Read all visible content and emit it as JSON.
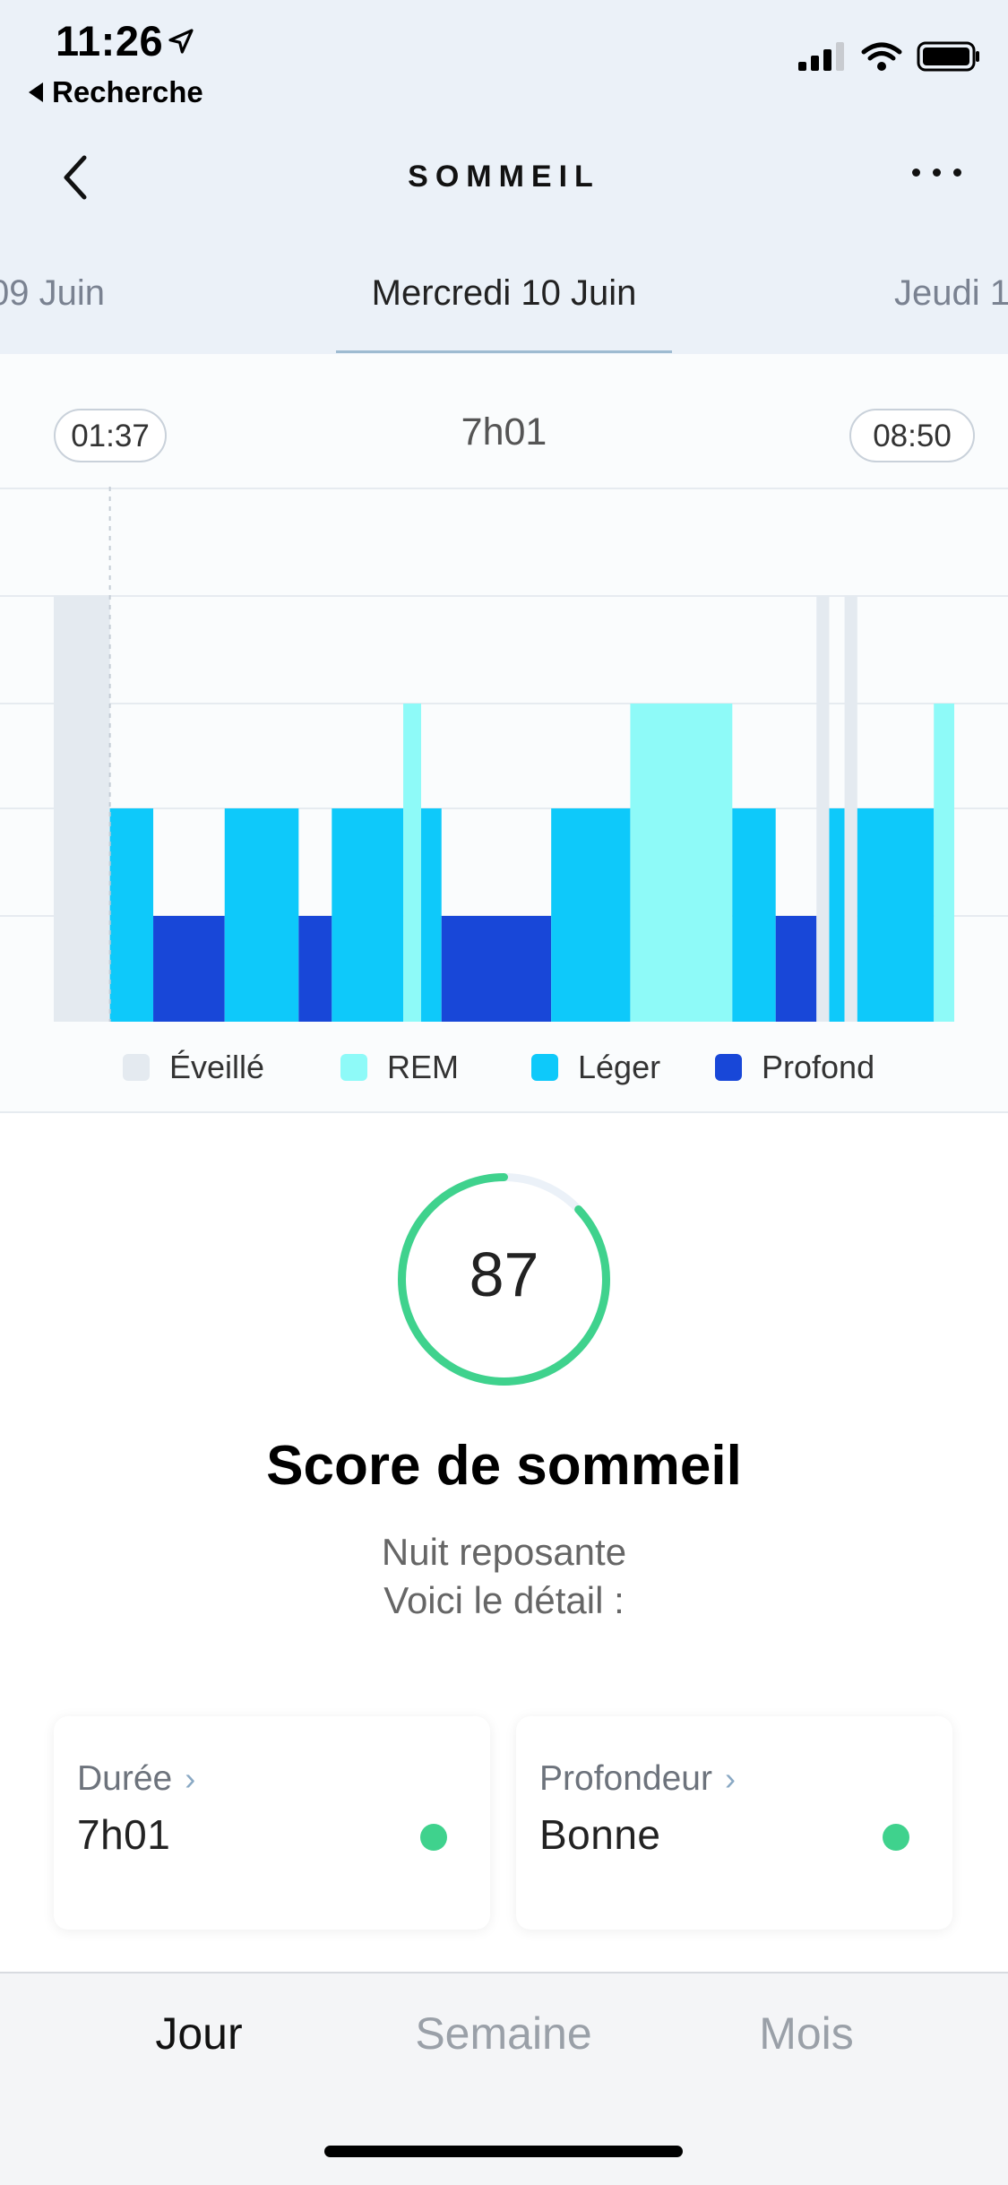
{
  "status_bar": {
    "time": "11:26",
    "back_app": "Recherche",
    "icons": [
      "location-arrow-icon",
      "cellular-signal-icon",
      "wifi-icon",
      "battery-icon"
    ]
  },
  "nav": {
    "title": "SOMMEIL",
    "back_icon": "chevron-left-icon",
    "more_icon": "more-dots-icon"
  },
  "days": {
    "prev": "09 Juin",
    "current": "Mercredi 10 Juin",
    "next": "Jeudi 1"
  },
  "chart_header": {
    "start": "01:37",
    "total": "7h01",
    "end": "08:50"
  },
  "chart_data": {
    "type": "bar",
    "title": "",
    "start_time": "01:37",
    "end_time": "08:50",
    "stage_order": [
      "Éveillé",
      "REM",
      "Léger",
      "Profond"
    ],
    "colors": {
      "Éveillé": "#e4eaf0",
      "REM": "#8efaf8",
      "Léger": "#0ec9fa",
      "Profond": "#1847d8"
    },
    "segments": [
      {
        "stage": "Éveillé",
        "from": "01:15",
        "to": "01:37"
      },
      {
        "stage": "Léger",
        "from": "01:37",
        "to": "01:54"
      },
      {
        "stage": "Profond",
        "from": "01:54",
        "to": "02:22"
      },
      {
        "stage": "Léger",
        "from": "02:22",
        "to": "02:51"
      },
      {
        "stage": "Profond",
        "from": "02:51",
        "to": "03:04"
      },
      {
        "stage": "Léger",
        "from": "03:04",
        "to": "03:32"
      },
      {
        "stage": "REM",
        "from": "03:32",
        "to": "03:39"
      },
      {
        "stage": "Léger",
        "from": "03:39",
        "to": "03:47"
      },
      {
        "stage": "Profond",
        "from": "03:47",
        "to": "04:30"
      },
      {
        "stage": "Léger",
        "from": "04:30",
        "to": "05:01"
      },
      {
        "stage": "REM",
        "from": "05:01",
        "to": "05:41"
      },
      {
        "stage": "Léger",
        "from": "05:41",
        "to": "05:58"
      },
      {
        "stage": "Profond",
        "from": "05:58",
        "to": "06:14"
      },
      {
        "stage": "Éveillé",
        "from": "06:14",
        "to": "06:19"
      },
      {
        "stage": "Léger",
        "from": "06:19",
        "to": "06:25"
      },
      {
        "stage": "Éveillé",
        "from": "06:25",
        "to": "06:30"
      },
      {
        "stage": "Léger",
        "from": "06:30",
        "to": "07:00"
      },
      {
        "stage": "REM",
        "from": "07:00",
        "to": "07:08"
      }
    ]
  },
  "legend": [
    {
      "label": "Éveillé",
      "color": "#e4eaf0"
    },
    {
      "label": "REM",
      "color": "#8efaf8"
    },
    {
      "label": "Léger",
      "color": "#0ec9fa"
    },
    {
      "label": "Profond",
      "color": "#1847d8"
    }
  ],
  "score": {
    "value": "87",
    "value_fraction": 0.87,
    "ring_color": "#3fd28d",
    "title": "Score de sommeil",
    "line1": "Nuit reposante",
    "line2": "Voici le détail :"
  },
  "cards": [
    {
      "label": "Durée",
      "value": "7h01",
      "status_color": "#3fd28d"
    },
    {
      "label": "Profondeur",
      "value": "Bonne",
      "status_color": "#3fd28d"
    }
  ],
  "bottom_tabs": {
    "day": "Jour",
    "week": "Semaine",
    "month": "Mois",
    "active": "Jour"
  }
}
